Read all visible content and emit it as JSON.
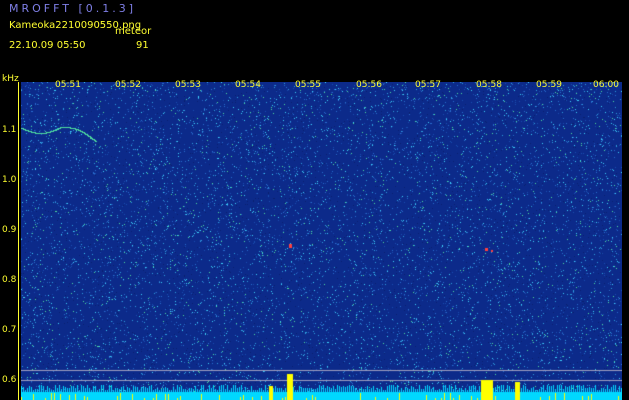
{
  "header": {
    "app_title": "MROFFT [0.1.3]",
    "file_name": "Kameoka2210090550.png",
    "meteor_label": "meteor",
    "datetime": "22.10.09 05:50",
    "meteor_count": "91"
  },
  "axes": {
    "unit_label": "kHz",
    "time_ticks": [
      "05:51",
      "05:52",
      "05:53",
      "05:54",
      "05:55",
      "05:56",
      "05:57",
      "05:58",
      "05:59",
      "06:00"
    ],
    "freq_ticks": [
      "1.1",
      "1.0",
      "0.9",
      "0.8",
      "0.7",
      "0.6"
    ]
  },
  "colors": {
    "background": "#000000",
    "plot_bg": "#0c2a8a",
    "text_yellow": "#ffff30",
    "title_blue": "#7f7fe6",
    "noise_cyan": "#3fd6ff",
    "meteor_red": "#ff4040",
    "bar_cyan": "#00d8ff",
    "bar_yellow": "#ffff00"
  }
}
